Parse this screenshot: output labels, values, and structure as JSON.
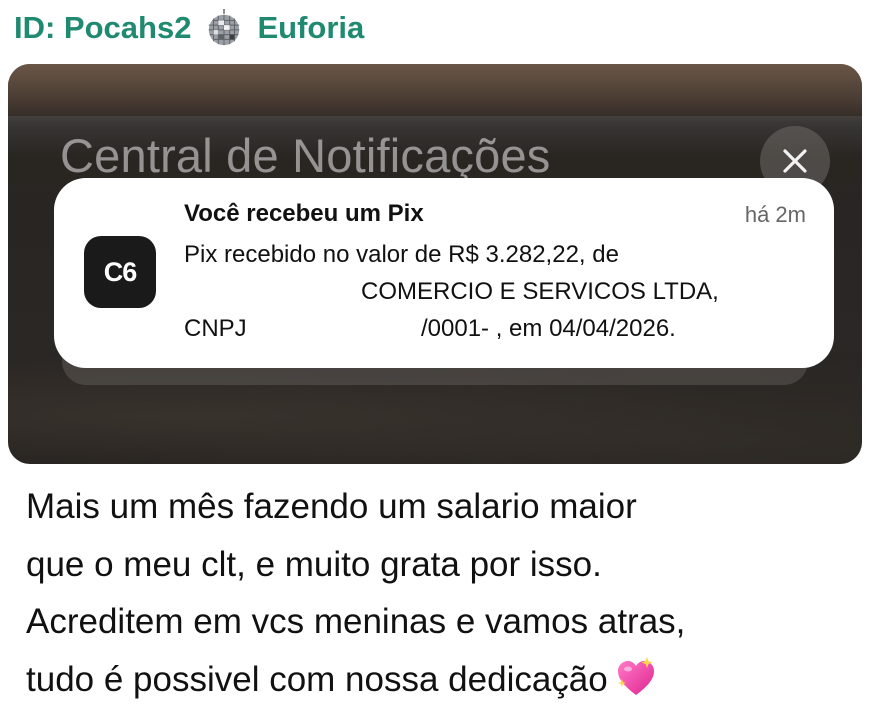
{
  "message": {
    "sender_id": "ID: Pocahs2",
    "sender_emoji_icon": "disco-ball-icon",
    "sender_name": "Euforia",
    "name_color": "#1f8a70"
  },
  "screenshot": {
    "header_title": "Central de Notificações",
    "close_icon": "close-icon",
    "notification": {
      "app_icon_label": "C6",
      "title": "Você recebeu um Pix",
      "time": "há 2m",
      "body_line1": "Pix recebido no valor de R$ 3.282,22, de",
      "body_line2": "COMERCIO E SERVICOS LTDA,",
      "body_line3_label": "CNPJ",
      "body_line3_rest": "/0001-    , em 04/04/2026."
    }
  },
  "caption": {
    "line1": "Mais um mês fazendo um salario maior",
    "line2": "que o meu clt, e muito grata por isso.",
    "line3": "Acreditem em vcs meninas e vamos atras,",
    "line4": "tudo é possivel com nossa dedicação",
    "trailing_emoji_icon": "sparkling-heart-icon"
  }
}
